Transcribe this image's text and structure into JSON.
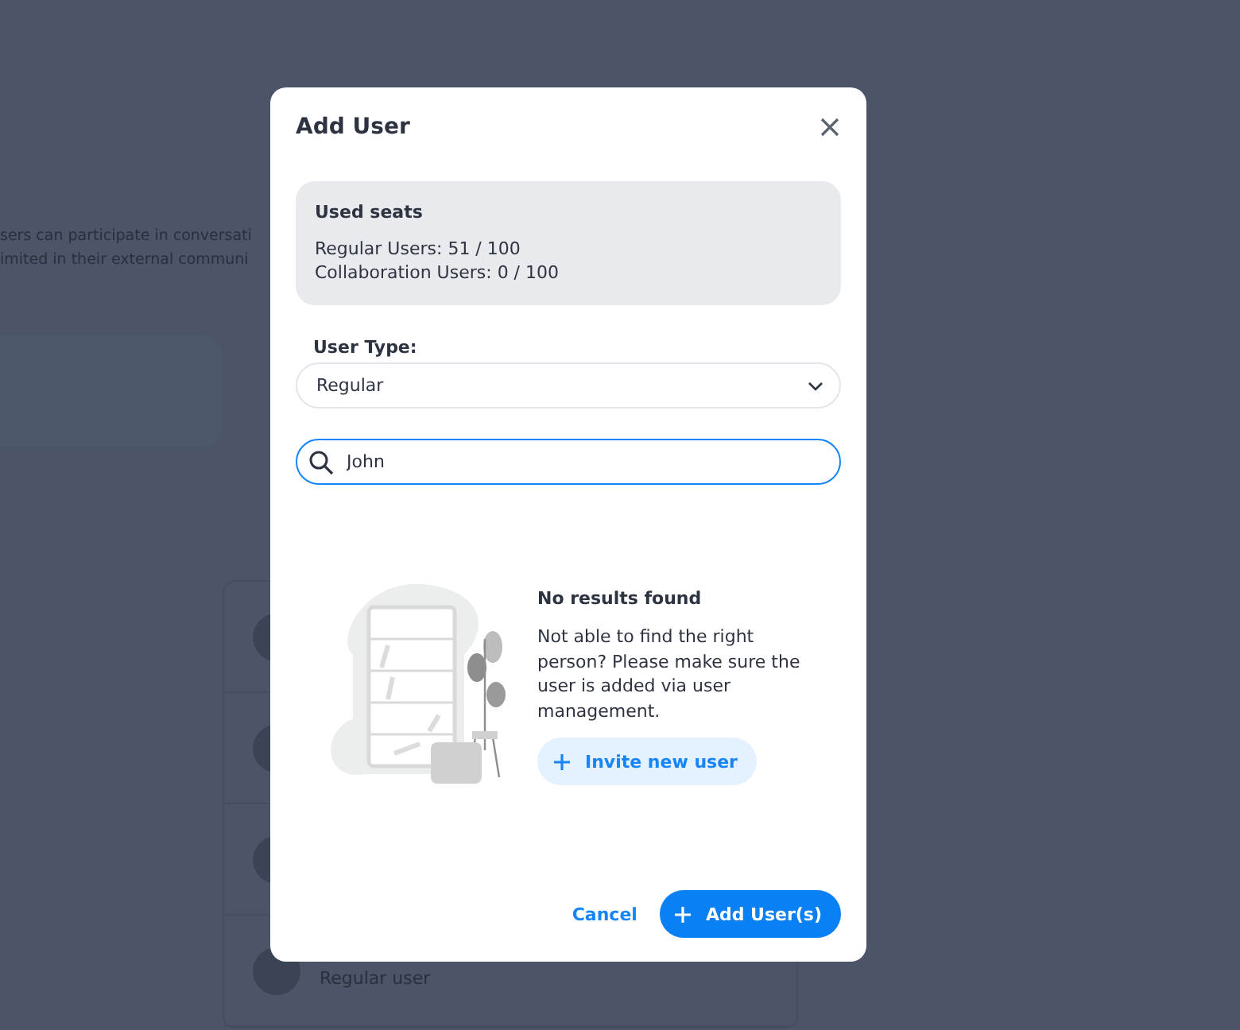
{
  "background": {
    "description_lines": [
      "sers can participate in conversati",
      "imited in their external communi"
    ],
    "user_rows": [
      {
        "kind": "avatar_only"
      },
      {
        "kind": "avatar_only"
      },
      {
        "kind": "avatar_only"
      },
      {
        "kind": "avatar_with_label",
        "label": "Regular user"
      }
    ]
  },
  "dialog": {
    "title": "Add User",
    "seats": {
      "heading": "Used seats",
      "lines": [
        "Regular Users: 51 / 100",
        "Collaboration Users: 0 / 100"
      ]
    },
    "user_type": {
      "label": "User Type:",
      "value": "Regular"
    },
    "search": {
      "value": "John",
      "focused": true
    },
    "empty_state": {
      "heading": "No results found",
      "message": "Not able to find the right person? Please make sure the user is added via user management.",
      "action": "Invite new user"
    },
    "buttons": [
      {
        "label": "Cancel",
        "kind": "link"
      },
      {
        "label": "Add User(s)",
        "kind": "primary"
      }
    ]
  }
}
